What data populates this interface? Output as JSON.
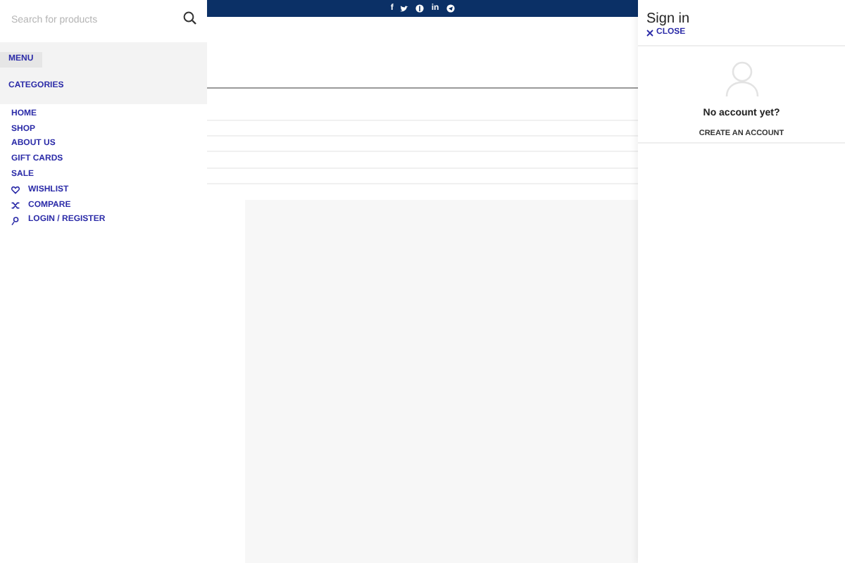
{
  "search": {
    "placeholder": "Search for products"
  },
  "menu_tabs": [
    {
      "label": "MENU",
      "selected": true
    }
  ],
  "categories": {
    "label": "CATEGORIES"
  },
  "nav_items": [
    {
      "label": "HOME",
      "kind": "link"
    },
    {
      "label": "SHOP",
      "kind": "link"
    },
    {
      "label": "ABOUT US",
      "kind": "link"
    },
    {
      "label": "GIFT CARDS",
      "kind": "link"
    },
    {
      "label": "SALE",
      "kind": "link"
    },
    {
      "label": "WISHLIST",
      "kind": "wishlist"
    },
    {
      "label": "COMPARE",
      "kind": "compare"
    },
    {
      "label": "LOGIN / REGISTER",
      "kind": "login"
    }
  ],
  "social_bar": {
    "icons": [
      "f",
      "in"
    ]
  },
  "sign_in_panel": {
    "title": "Sign in",
    "close": "CLOSE",
    "no_account": "No account yet?",
    "create_account": "CREATE AN ACCOUNT"
  }
}
